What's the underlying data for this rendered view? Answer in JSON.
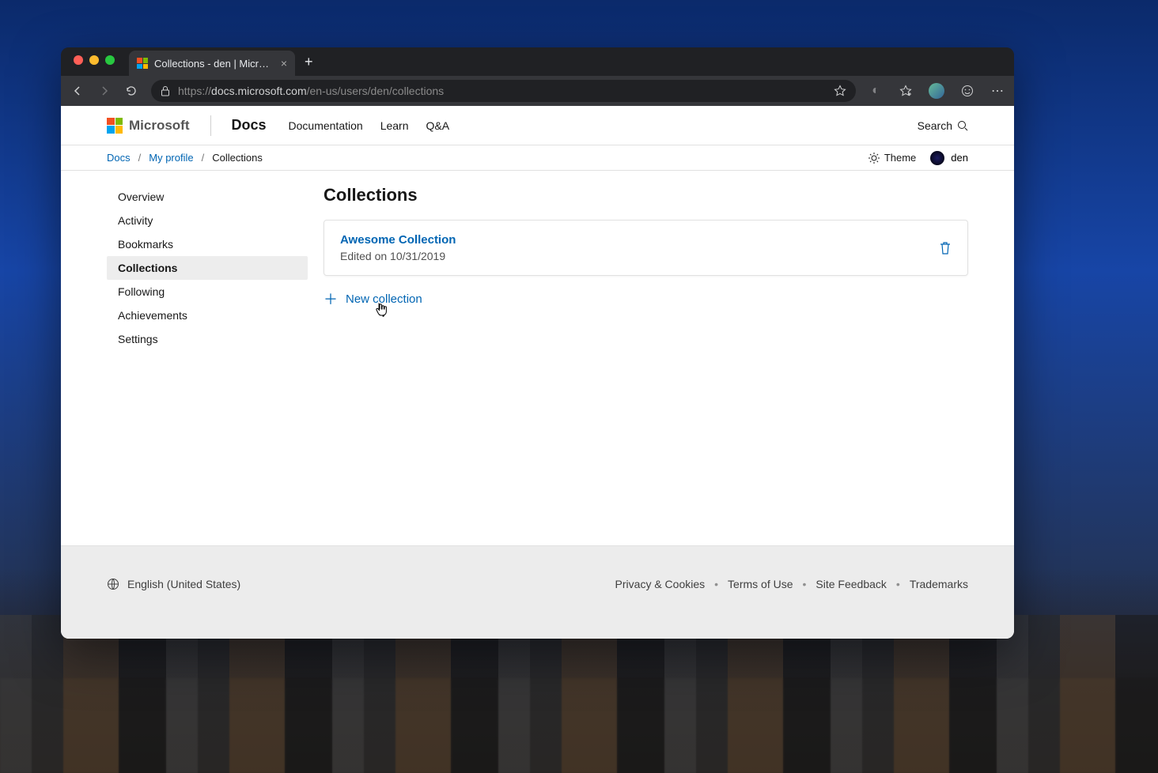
{
  "browser": {
    "tab_title": "Collections - den | Microsoft Do",
    "url_prefix": "https://",
    "url_host": "docs.microsoft.com",
    "url_path": "/en-us/users/den/collections"
  },
  "header": {
    "brand": "Microsoft",
    "product": "Docs",
    "nav": {
      "documentation": "Documentation",
      "learn": "Learn",
      "qa": "Q&A"
    },
    "search_label": "Search"
  },
  "subheader": {
    "crumbs": {
      "docs": "Docs",
      "profile": "My profile",
      "current": "Collections"
    },
    "theme_label": "Theme",
    "username": "den"
  },
  "sidebar": {
    "overview": "Overview",
    "activity": "Activity",
    "bookmarks": "Bookmarks",
    "collections": "Collections",
    "following": "Following",
    "achievements": "Achievements",
    "settings": "Settings"
  },
  "main": {
    "title": "Collections",
    "card": {
      "title": "Awesome Collection",
      "subtitle": "Edited on 10/31/2019"
    },
    "new_collection": "New collection"
  },
  "footer": {
    "language": "English (United States)",
    "links": {
      "privacy": "Privacy & Cookies",
      "terms": "Terms of Use",
      "feedback": "Site Feedback",
      "trademarks": "Trademarks"
    }
  }
}
